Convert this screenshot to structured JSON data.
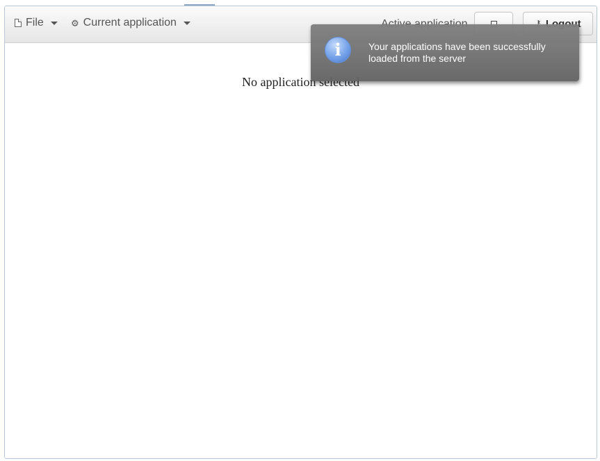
{
  "navbar": {
    "file_label": "File",
    "current_app_label": "Current application",
    "active_app_label": "Active application",
    "logout_label": "Logout"
  },
  "main": {
    "empty_message": "No application selected"
  },
  "notification": {
    "icon": "info-icon",
    "message": "Your applications have been successfully loaded from the server"
  },
  "colors": {
    "toast_bg": "#6e6e6e",
    "info_icon_blue": "#5f90e0",
    "border": "#b7c7d8"
  }
}
